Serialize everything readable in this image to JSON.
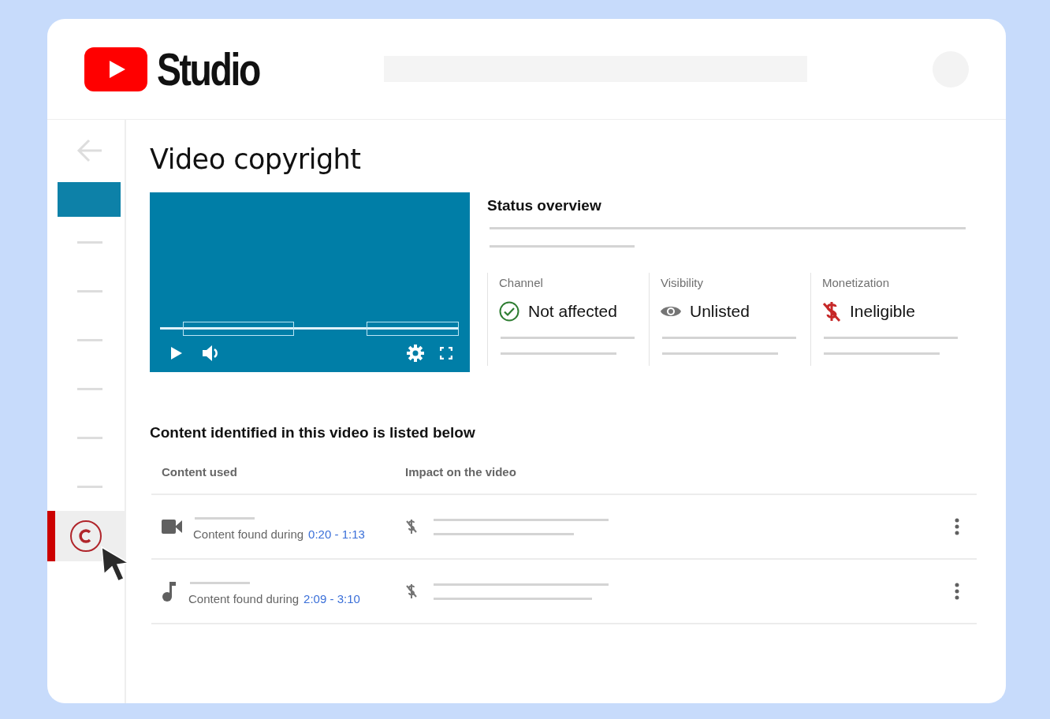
{
  "header": {
    "logo_text": "Studio"
  },
  "sidebar": {
    "items": [
      {
        "kind": "back",
        "selected": false
      },
      {
        "kind": "thumbnail",
        "selected": false
      },
      {
        "kind": "line",
        "selected": false
      },
      {
        "kind": "line",
        "selected": false
      },
      {
        "kind": "line",
        "selected": false
      },
      {
        "kind": "line",
        "selected": false
      },
      {
        "kind": "line",
        "selected": false
      },
      {
        "kind": "line",
        "selected": false
      },
      {
        "kind": "copyright",
        "selected": true
      }
    ]
  },
  "page_title": "Video copyright",
  "status_overview": {
    "title": "Status overview",
    "columns": [
      {
        "label": "Channel",
        "value": "Not affected",
        "kind": "ok"
      },
      {
        "label": "Visibility",
        "value": "Unlisted",
        "kind": "unlisted"
      },
      {
        "label": "Monetization",
        "value": "Ineligible",
        "kind": "ineligible"
      }
    ]
  },
  "content": {
    "title": "Content identified in this video is listed below",
    "columns": [
      "Content used",
      "Impact on the video"
    ],
    "rows": [
      {
        "kind": "video",
        "text": "Content found during",
        "range": "0:20 - 1:13"
      },
      {
        "kind": "audio",
        "text": "Content found during",
        "range": "2:09 - 3:10"
      }
    ]
  }
}
